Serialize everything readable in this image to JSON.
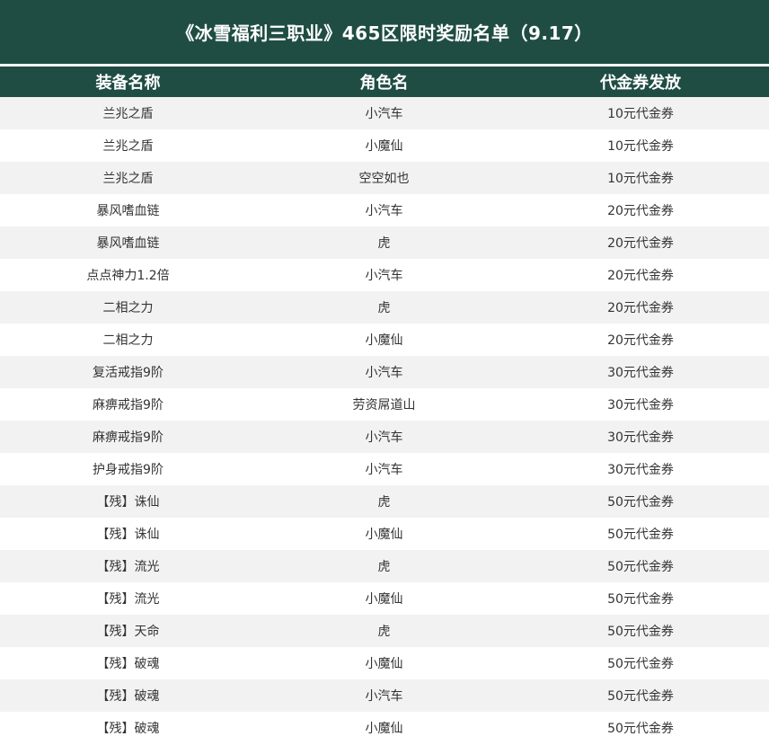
{
  "title": "《冰雪福利三职业》465区限时奖励名单（9.17）",
  "colors": {
    "header_bg": "#1f4d44",
    "header_text": "#ffffff",
    "row_alt_bg": "#f2f2f2",
    "row_bg": "#ffffff",
    "cell_text": "#333333"
  },
  "table": {
    "headers": [
      "装备名称",
      "角色名",
      "代金券发放"
    ],
    "rows": [
      [
        "兰兆之盾",
        "小汽车",
        "10元代金券"
      ],
      [
        "兰兆之盾",
        "小魔仙",
        "10元代金券"
      ],
      [
        "兰兆之盾",
        "空空如也",
        "10元代金券"
      ],
      [
        "暴风嗜血链",
        "小汽车",
        "20元代金券"
      ],
      [
        "暴风嗜血链",
        "虎",
        "20元代金券"
      ],
      [
        "点点神力1.2倍",
        "小汽车",
        "20元代金券"
      ],
      [
        "二相之力",
        "虎",
        "20元代金券"
      ],
      [
        "二相之力",
        "小魔仙",
        "20元代金券"
      ],
      [
        "复活戒指9阶",
        "小汽车",
        "30元代金券"
      ],
      [
        "麻痹戒指9阶",
        "劳资屌道山",
        "30元代金券"
      ],
      [
        "麻痹戒指9阶",
        "小汽车",
        "30元代金券"
      ],
      [
        "护身戒指9阶",
        "小汽车",
        "30元代金券"
      ],
      [
        "【残】诛仙",
        "虎",
        "50元代金券"
      ],
      [
        "【残】诛仙",
        "小魔仙",
        "50元代金券"
      ],
      [
        "【残】流光",
        "虎",
        "50元代金券"
      ],
      [
        "【残】流光",
        "小魔仙",
        "50元代金券"
      ],
      [
        "【残】天命",
        "虎",
        "50元代金券"
      ],
      [
        "【残】破魂",
        "小魔仙",
        "50元代金券"
      ],
      [
        "【残】破魂",
        "小汽车",
        "50元代金券"
      ],
      [
        "【残】破魂",
        "小魔仙",
        "50元代金券"
      ]
    ]
  }
}
